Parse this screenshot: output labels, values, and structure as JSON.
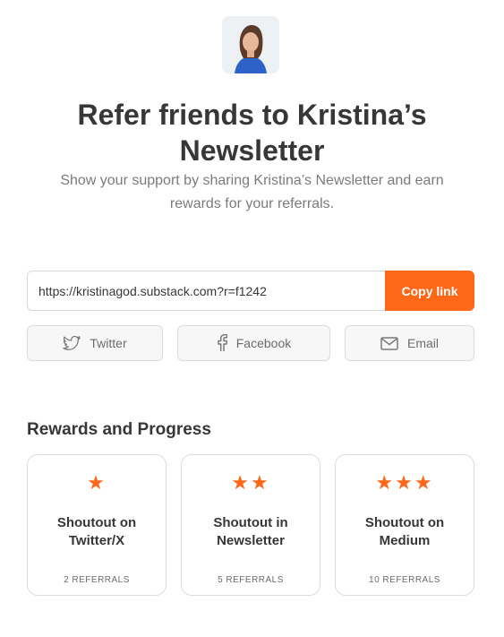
{
  "header": {
    "avatar_icon": "author-portrait",
    "title": "Refer friends to Kristina’s Newsletter",
    "subtitle": "Show your support by sharing Kristina’s Newsletter and earn rewards for your referrals."
  },
  "share_link": {
    "url": "https://kristinagod.substack.com?r=f1242",
    "copy_label": "Copy link"
  },
  "share_buttons": [
    {
      "label": "Twitter",
      "icon": "twitter-icon"
    },
    {
      "label": "Facebook",
      "icon": "facebook-icon"
    },
    {
      "label": "Email",
      "icon": "email-icon"
    }
  ],
  "rewards": {
    "heading": "Rewards and Progress",
    "cards": [
      {
        "stars": "★",
        "star_count": 1,
        "title": "Shoutout on Twitter/X",
        "referrals": "2 REFERRALS"
      },
      {
        "stars": "★★",
        "star_count": 2,
        "title": "Shoutout in Newsletter",
        "referrals": "5 REFERRALS"
      },
      {
        "stars": "★★★",
        "star_count": 3,
        "title": "Shoutout on Medium",
        "referrals": "10 REFERRALS"
      }
    ]
  },
  "colors": {
    "accent": "#ff6719",
    "text": "#363737",
    "muted": "#7b7b7b"
  }
}
